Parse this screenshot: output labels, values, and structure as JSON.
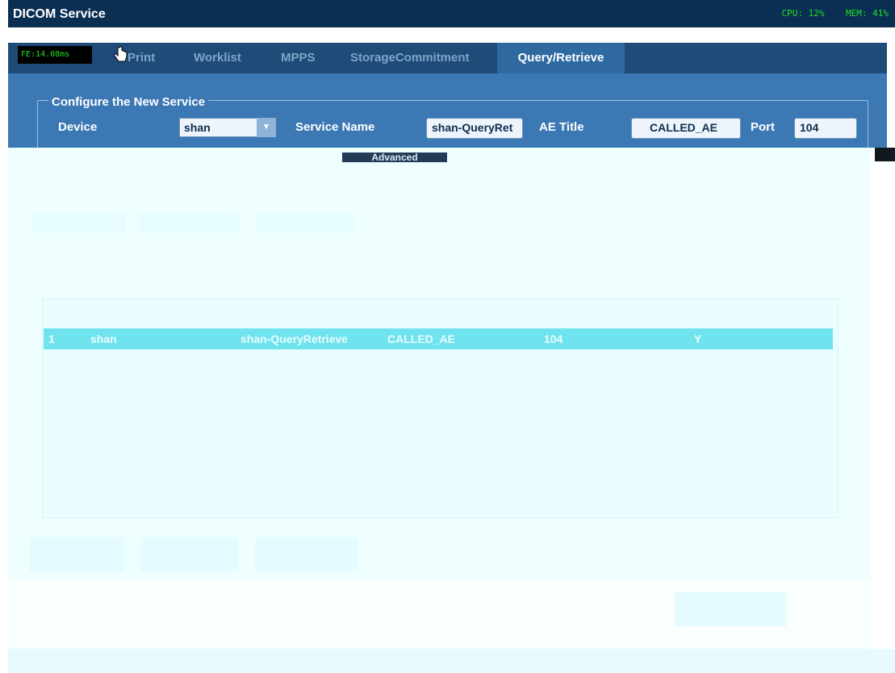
{
  "window": {
    "title": "DICOM Service"
  },
  "status": {
    "cpu": "CPU: 12%",
    "mem": "MEM: 41%",
    "frame_time": "FE:14.08ms"
  },
  "tabs": [
    {
      "label": "Print",
      "active": false
    },
    {
      "label": "Worklist",
      "active": false
    },
    {
      "label": "MPPS",
      "active": false
    },
    {
      "label": "StorageCommitment",
      "active": false
    },
    {
      "label": "Query/Retrieve",
      "active": true
    }
  ],
  "config": {
    "legend": "Configure the New Service",
    "device_label": "Device",
    "device_value": "shan",
    "service_name_label": "Service Name",
    "service_name_value": "shan-QueryRet",
    "ae_title_label": "AE Title",
    "ae_title_value": "CALLED_AE",
    "port_label": "Port",
    "port_value": "104",
    "advanced_label": "Advanced"
  },
  "table": {
    "rows": [
      {
        "index": "1",
        "device": "shan",
        "service_name": "shan-QueryRetrieve",
        "ae_title": "CALLED_AE",
        "port": "104",
        "default": "Y"
      }
    ]
  },
  "colors": {
    "titlebar": "#0b2f52",
    "panel": "#3b78b4",
    "active_tab": "#2e6aa0",
    "overlay": "#effeff",
    "selected_row": "#6fe3ee",
    "status_text": "#21e021"
  },
  "icons": {
    "cursor": "hand-pointer-icon",
    "dropdown": "chevron-down-icon"
  }
}
